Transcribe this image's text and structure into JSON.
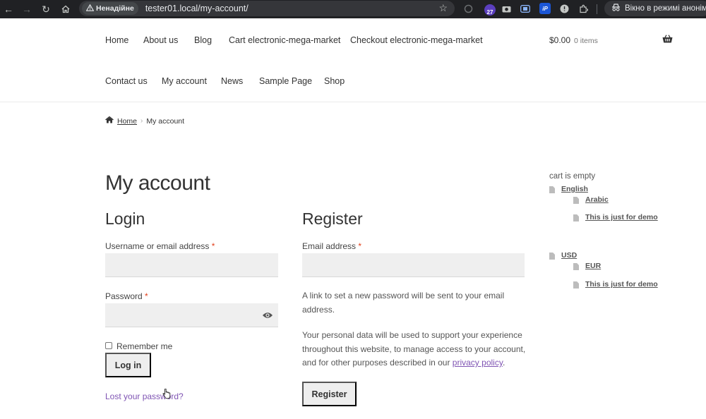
{
  "browser": {
    "security_label": "Ненадійне",
    "url": "tester01.local/my-account/",
    "extension_badge": "27",
    "extension_ip_label": "iP",
    "incognito_label": "Вікно в режимі анонімного перегляду",
    "icons": [
      "back-icon",
      "forward-icon",
      "reload-icon",
      "home-icon",
      "warning-icon",
      "star-icon",
      "extension-icon",
      "camera-icon",
      "screen-icon",
      "puzzle-icon",
      "incognito-icon"
    ]
  },
  "menu": {
    "items": [
      {
        "label": "Home"
      },
      {
        "label": "About us"
      },
      {
        "label": "Blog"
      },
      {
        "label": "Cart electronic-mega-market"
      },
      {
        "label": "Checkout electronic-mega-market"
      },
      {
        "label": "Contact us"
      },
      {
        "label": "My account"
      },
      {
        "label": "News"
      },
      {
        "label": "Sample Page"
      },
      {
        "label": "Shop"
      }
    ]
  },
  "cart": {
    "total": "$0.00",
    "count": "0 items"
  },
  "breadcrumb": {
    "home": "Home",
    "current": "My account"
  },
  "page": {
    "title": "My account"
  },
  "login": {
    "title": "Login",
    "username_label": "Username or email address",
    "password_label": "Password",
    "required_mark": "*",
    "remember_label": "Remember me",
    "submit_label": "Log in",
    "lost_password": "Lost your password?"
  },
  "register": {
    "title": "Register",
    "email_label": "Email address",
    "required_mark": "*",
    "info_line1": "A link to set a new password will be sent to your email",
    "info_line2": "address.",
    "privacy_line1": "Your personal data will be used to support your experience",
    "privacy_line2": "throughout this website, to manage access to your account,",
    "privacy_line3_prefix": "and for other purposes described in our ",
    "privacy_link": "privacy policy",
    "privacy_line3_suffix": ".",
    "submit_label": "Register"
  },
  "sidebar": {
    "cart_empty": "cart is empty",
    "language": {
      "current": "English",
      "options": [
        "Arabic",
        "This is just for demo"
      ]
    },
    "currency": {
      "current": "USD",
      "options": [
        "EUR",
        "This is just for demo"
      ]
    }
  },
  "colors": {
    "link_purple": "#7f54b3",
    "required_red": "#e2401c",
    "field_bg": "#efefef",
    "button_bg": "#eeeeee",
    "chrome_bg": "#202124"
  }
}
